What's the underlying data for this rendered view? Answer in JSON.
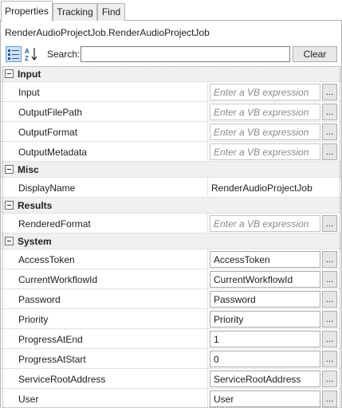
{
  "tabs": [
    "Properties",
    "Tracking",
    "Find"
  ],
  "activity_title": "RenderAudioProjectJob.RenderAudioProjectJob",
  "toolbar": {
    "categorized_icon": "categorized-view-icon",
    "alphabetical_icon": "sort-az-icon",
    "search_label": "Search:",
    "search_value": "",
    "clear_label": "Clear"
  },
  "placeholder": "Enter a VB expression",
  "ellipsis": "...",
  "categories": [
    {
      "name": "Input",
      "props": [
        {
          "name": "Input",
          "value": ""
        },
        {
          "name": "OutputFilePath",
          "value": ""
        },
        {
          "name": "OutputFormat",
          "value": ""
        },
        {
          "name": "OutputMetadata",
          "value": ""
        }
      ]
    },
    {
      "name": "Misc",
      "props": [
        {
          "name": "DisplayName",
          "value": "RenderAudioProjectJob"
        }
      ]
    },
    {
      "name": "Results",
      "props": [
        {
          "name": "RenderedFormat",
          "value": ""
        }
      ]
    },
    {
      "name": "System",
      "props": [
        {
          "name": "AccessToken",
          "value": "AccessToken"
        },
        {
          "name": "CurrentWorkflowId",
          "value": "CurrentWorkflowId"
        },
        {
          "name": "Password",
          "value": "Password"
        },
        {
          "name": "Priority",
          "value": "Priority"
        },
        {
          "name": "ProgressAtEnd",
          "value": "1"
        },
        {
          "name": "ProgressAtStart",
          "value": "0"
        },
        {
          "name": "ServiceRootAddress",
          "value": "ServiceRootAddress"
        },
        {
          "name": "User",
          "value": "User"
        }
      ]
    }
  ]
}
